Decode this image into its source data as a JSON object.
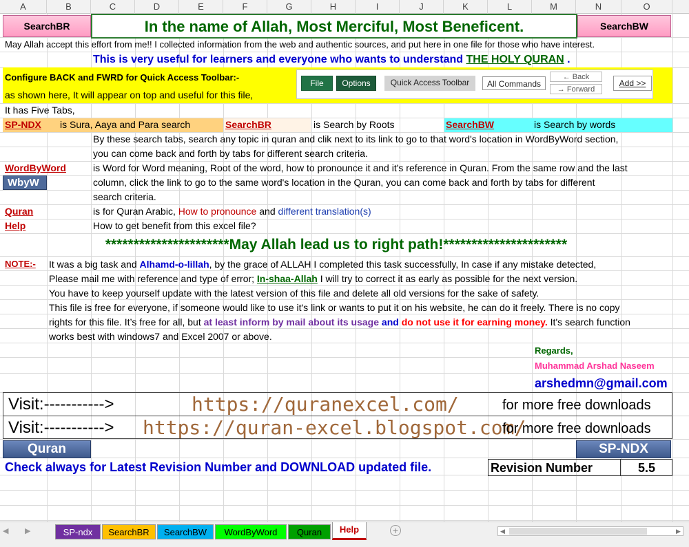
{
  "columns": [
    "A",
    "B",
    "C",
    "D",
    "E",
    "F",
    "G",
    "H",
    "I",
    "J",
    "K",
    "L",
    "M",
    "N",
    "O"
  ],
  "header": {
    "searchbr_button": "SearchBR",
    "title": "In the name of Allah, Most Merciful, Most Beneficent.",
    "searchbw_button": "SearchBW"
  },
  "intro": {
    "line1": "May Allah accept this effort from me!!  I collected information from the web and authentic sources, and put here in one file for those who have interest.",
    "line2_prefix": "This is very useful for learners and everyone who wants to understand ",
    "line2_link": "THE HOLY QURAN",
    "line2_suffix": " ."
  },
  "toolbar": {
    "heading": "Configure BACK and FWRD for Quick Access Toolbar:-",
    "line2": "as shown here, It will appear on top and useful for this file,",
    "file_button": "File",
    "options_button": "Options",
    "qat_button": "Quick Access Toolbar",
    "all_commands_button": "All Commands",
    "back_label": "Back",
    "forward_label": "Forward",
    "add_button": "Add >>"
  },
  "tabs_intro": {
    "text": "It has Five Tabs,",
    "spndx_link": "SP-NDX",
    "spndx_desc": "is Sura, Aaya and Para search",
    "searchbr_link": "SearchBR",
    "searchbr_desc": "is Search by Roots",
    "searchbw_link": "SearchBW",
    "searchbw_desc": "is Search by words",
    "search_line1": "By these search tabs, search any topic in quran and clik next to its link to go to that word's location in WordByWord section,",
    "search_line2": "you can come back and forth by tabs for different search criteria."
  },
  "wbw": {
    "link": "WordByWord",
    "button": "WbyW",
    "line1": "is Word for Word meaning, Root of the word, how to pronounce it and it's reference in Quran. From the same row and the last",
    "line2": "column, click the link to go to the same word's location in the Quran, you can come back and forth by tabs for different",
    "line3": "search criteria."
  },
  "quran_row": {
    "link": "Quran",
    "part1": "is for Quran Arabic, ",
    "part2": "How to pronounce",
    "part3": " and  ",
    "part4": "different translation(s)"
  },
  "help_row": {
    "link": "Help",
    "text": "How to get benefit from this excel file?"
  },
  "banner": "**********************May Allah lead us to right path!**********************",
  "note": {
    "label": "NOTE:-",
    "l1_a": "It was a big task and ",
    "l1_b": "Alhamd-o-lillah",
    "l1_c": ", by the grace of ALLAH I completed this task successfully, In case if any mistake detected,",
    "l2_a": "Please mail me with reference and type of error; ",
    "l2_b": "In-shaa-Allah",
    "l2_c": " I will try to correct it as early as possible for the next version.",
    "l3": "You have to keep yourself update with the latest version of this file and delete all old versions for the sake of safety.",
    "l4": "This file is free for everyone, if someone would like to use it's link or wants to put it on his website, he can do it freely. There is no copy",
    "l5_a": "rights for this file. It’s free for all, but ",
    "l5_b": "at least inform by mail about its usage",
    "l5_c": " and ",
    "l5_d": "do not use it for earning money.",
    "l5_e": "  It's search function",
    "l6": "works best with windows7 and Excel 2007 or above."
  },
  "regards": {
    "label": "Regards,",
    "name": "Muhammad Arshad Naseem",
    "email": "arshedmn@gmail.com"
  },
  "visit": [
    {
      "label": "Visit:----------->",
      "url": "https://quranexcel.com/",
      "note": "for more free downloads"
    },
    {
      "label": "Visit:----------->",
      "url": "https://quran-excel.blogspot.com/",
      "note": "for more free downloads"
    }
  ],
  "bottom": {
    "quran_button": "Quran",
    "spndx_button": "SP-NDX",
    "check_text": "Check always for Latest Revision Number and DOWNLOAD updated file.",
    "revision_label": "Revision Number",
    "revision_value": "5.5"
  },
  "sheet_tabs": [
    "SP-ndx",
    "SearchBR",
    "SearchBW",
    "WordByWord",
    "Quran",
    "Help"
  ],
  "colors": {
    "yellow": "#ffff00",
    "pink": "#ff9cc3",
    "cyan": "#66ffff",
    "navy_button": "#4f6b9b",
    "title_green": "#006600"
  }
}
